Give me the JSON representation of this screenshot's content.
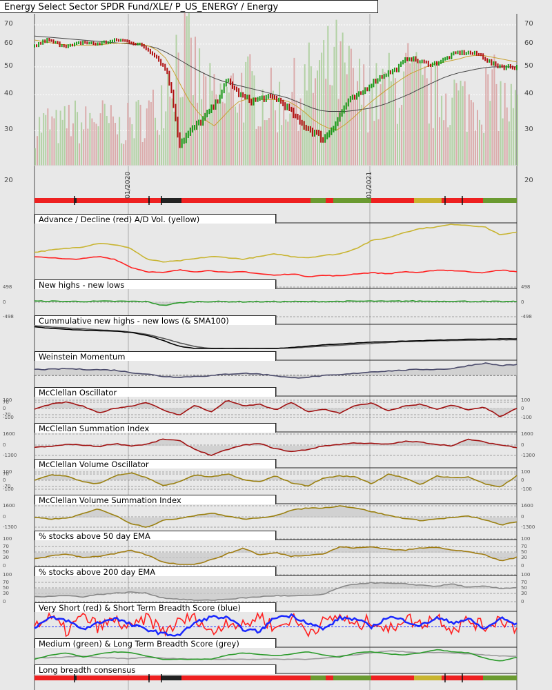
{
  "title": "Energy Select Sector SPDR Fund/XLE/ P_US_ENERGY / Energy",
  "chart_data": {
    "type": "line",
    "x_ticks": [
      "01/2020",
      "01/2021"
    ],
    "price": {
      "y_ticks": [
        "70",
        "60",
        "50",
        "40",
        "30",
        "20"
      ],
      "close": [
        59,
        62,
        60,
        59,
        61,
        60,
        61,
        62,
        61,
        59,
        55,
        48,
        27,
        30,
        33,
        37,
        45,
        40,
        38,
        39,
        39,
        36,
        32,
        30,
        28,
        32,
        38,
        40,
        44,
        47,
        49,
        54,
        52,
        51,
        53,
        56,
        56,
        55,
        51,
        50,
        50
      ],
      "sma200": [
        64,
        63.5,
        63,
        62.5,
        62,
        61.5,
        61,
        60.5,
        60,
        59.5,
        58.5,
        56,
        53,
        50,
        47.5,
        45.5,
        44,
        43,
        42,
        41,
        40,
        39,
        37.5,
        36,
        35,
        35,
        35,
        35.5,
        36,
        37,
        38.5,
        40,
        42,
        44,
        46,
        47.5,
        48.5,
        49.5,
        50,
        50,
        50
      ],
      "sma50": [
        62,
        61,
        60,
        59.5,
        59.5,
        59.5,
        60,
        60.5,
        60.5,
        60,
        58,
        53,
        44,
        37,
        33,
        31,
        35,
        38,
        39,
        38.5,
        38.5,
        38,
        36,
        33,
        31,
        30,
        32,
        35,
        38,
        41,
        44,
        47,
        49,
        51,
        52,
        53,
        54.5,
        55,
        54,
        53,
        52
      ],
      "volume": [
        30,
        35,
        30,
        38,
        32,
        40,
        35,
        30,
        35,
        40,
        45,
        70,
        95,
        80,
        60,
        50,
        55,
        65,
        60,
        55,
        50,
        55,
        60,
        70,
        75,
        80,
        70,
        60,
        55,
        60,
        65,
        70,
        60,
        55,
        60,
        55,
        50,
        55,
        60,
        50,
        45
      ]
    },
    "panels": [
      {
        "title": "Advance / Decline (red) A/D Vol. (yellow)",
        "series": [
          {
            "name": "A/D Vol.",
            "color": "#c8b430",
            "values": [
              48,
              52,
              55,
              58,
              65,
              62,
              55,
              35,
              30,
              32,
              36,
              40,
              38,
              35,
              40,
              45,
              40,
              38,
              42,
              45,
              55,
              70,
              75,
              85,
              92,
              95,
              100,
              98,
              95,
              80,
              85
            ]
          },
          {
            "name": "Advance / Decline",
            "color": "#ff2020",
            "values": [
              40,
              38,
              35,
              36,
              40,
              35,
              20,
              12,
              10,
              15,
              12,
              14,
              10,
              12,
              8,
              5,
              8,
              3,
              5,
              4,
              8,
              10,
              8,
              12,
              10,
              15,
              14,
              12,
              10,
              15,
              12
            ]
          }
        ]
      },
      {
        "title": "New highs - new lows",
        "ticks": [
          "498",
          "0",
          "-498"
        ],
        "series": [
          {
            "name": "NH-NL",
            "color": "#2a9a2a",
            "values": [
              30,
              25,
              20,
              18,
              22,
              25,
              20,
              10,
              -150,
              -40,
              10,
              15,
              10,
              5,
              8,
              10,
              12,
              10,
              15,
              20,
              25,
              30,
              20,
              35,
              30,
              25,
              30,
              20,
              15,
              10,
              12
            ]
          }
        ]
      },
      {
        "title": "Cummulative new highs - new lows (& SMA100)",
        "series": [
          {
            "name": "SMA100",
            "color": "#555",
            "values": [
              100,
              95,
              90,
              86,
              82,
              78,
              72,
              62,
              45,
              25,
              8,
              0,
              0,
              0,
              0,
              0,
              2,
              6,
              10,
              14,
              18,
              22,
              26,
              30,
              32,
              34,
              35,
              36,
              37,
              38,
              38
            ]
          },
          {
            "name": "Cumulative",
            "color": "#000",
            "values": [
              95,
              88,
              84,
              80,
              78,
              76,
              70,
              58,
              35,
              10,
              0,
              0,
              0,
              0,
              0,
              0,
              4,
              10,
              16,
              20,
              24,
              28,
              30,
              32,
              34,
              36,
              38,
              40,
              41,
              42,
              42
            ]
          }
        ]
      },
      {
        "title": "Weinstein Momentum",
        "series": [
          {
            "name": "Momentum",
            "color": "#4a4a6a",
            "values": [
              50,
              50,
              55,
              50,
              48,
              45,
              30,
              20,
              5,
              0,
              5,
              10,
              20,
              25,
              20,
              10,
              -5,
              0,
              10,
              15,
              25,
              35,
              40,
              45,
              50,
              50,
              55,
              75,
              90,
              75,
              80
            ]
          }
        ]
      },
      {
        "title": "McClellan Oscillator",
        "ticks": [
          "100",
          "70",
          "0",
          "-70",
          "-100"
        ],
        "series": [
          {
            "name": "Oscillator",
            "color": "#a01010",
            "values": [
              -10,
              40,
              60,
              20,
              -50,
              0,
              20,
              60,
              -20,
              -70,
              30,
              -40,
              80,
              20,
              40,
              -20,
              60,
              -40,
              -10,
              -50,
              30,
              50,
              -30,
              20,
              40,
              -10,
              30,
              -20,
              10,
              -90,
              0
            ]
          }
        ]
      },
      {
        "title": "McClellan Summation Index",
        "ticks": [
          "1600",
          "0",
          "-1300"
        ],
        "series": [
          {
            "name": "Summation",
            "color": "#a01010",
            "values": [
              -200,
              -100,
              200,
              100,
              -100,
              300,
              0,
              200,
              900,
              700,
              -500,
              -1300,
              -500,
              100,
              300,
              -400,
              -800,
              -500,
              0,
              200,
              400,
              300,
              200,
              600,
              500,
              200,
              0,
              900,
              500,
              100,
              -200
            ]
          }
        ]
      },
      {
        "title": "McClellan Volume Oscillator",
        "ticks": [
          "100",
          "70",
          "0",
          "-70",
          "-100"
        ],
        "series": [
          {
            "name": "Vol Oscillator",
            "color": "#9a8010",
            "values": [
              0,
              50,
              40,
              -20,
              -40,
              40,
              70,
              20,
              -60,
              -20,
              50,
              30,
              60,
              0,
              -20,
              40,
              -30,
              -60,
              20,
              40,
              30,
              -40,
              60,
              20,
              -50,
              40,
              20,
              30,
              -40,
              -70,
              40
            ]
          }
        ]
      },
      {
        "title": "McClellan Volume Summation Index",
        "ticks": [
          "1600",
          "0",
          "-1300"
        ],
        "series": [
          {
            "name": "Vol Summation",
            "color": "#9a8010",
            "values": [
              0,
              -200,
              -100,
              500,
              1200,
              300,
              -800,
              -1300,
              -400,
              -100,
              300,
              600,
              200,
              -200,
              -100,
              300,
              1000,
              1300,
              1300,
              1600,
              1300,
              800,
              300,
              -100,
              -400,
              -200,
              0,
              200,
              -300,
              -1000,
              -600
            ]
          }
        ]
      },
      {
        "title": "% stocks above 50 day EMA",
        "ticks": [
          "100",
          "70",
          "50",
          "30",
          "0"
        ],
        "series": [
          {
            "name": "% > 50 EMA",
            "color": "#a07c10",
            "values": [
              25,
              35,
              45,
              30,
              35,
              45,
              60,
              40,
              10,
              0,
              0,
              20,
              45,
              70,
              40,
              50,
              35,
              40,
              45,
              75,
              70,
              75,
              65,
              60,
              70,
              75,
              60,
              55,
              40,
              15,
              30
            ]
          }
        ]
      },
      {
        "title": "% stocks above 200 day EMA",
        "ticks": [
          "100",
          "70",
          "50",
          "30",
          "0"
        ],
        "series": [
          {
            "name": "% > 200 EMA",
            "color": "#888",
            "values": [
              15,
              18,
              20,
              15,
              25,
              30,
              35,
              30,
              10,
              5,
              0,
              0,
              5,
              10,
              15,
              20,
              18,
              20,
              25,
              55,
              70,
              75,
              72,
              70,
              65,
              60,
              70,
              55,
              60,
              50,
              55
            ]
          }
        ]
      },
      {
        "title": "Very Short (red) & Short Term Breadth Score (blue)",
        "series": [
          {
            "name": "Very Short",
            "color": "#ff2020",
            "values": [
              50,
              80,
              20,
              90,
              40,
              70,
              30,
              85,
              20,
              60,
              90,
              10,
              70,
              40,
              95,
              30,
              80,
              20,
              60,
              90,
              40,
              75,
              20,
              85,
              50,
              90,
              30,
              70,
              40,
              80,
              30
            ]
          },
          {
            "name": "Short",
            "color": "#1a28ff",
            "values": [
              40,
              80,
              70,
              30,
              60,
              80,
              50,
              30,
              10,
              5,
              60,
              85,
              80,
              30,
              20,
              85,
              90,
              60,
              30,
              80,
              75,
              40,
              85,
              70,
              45,
              80,
              60,
              75,
              30,
              80,
              50
            ]
          }
        ]
      },
      {
        "title": "Medium (green) & Long Term Breadth Score (grey)",
        "series": [
          {
            "name": "Long",
            "color": "#999",
            "values": [
              10,
              15,
              20,
              30,
              15,
              10,
              5,
              20,
              10,
              5,
              0,
              0,
              0,
              0,
              0,
              0,
              0,
              0,
              10,
              30,
              40,
              60,
              80,
              70,
              60,
              65,
              60,
              50,
              40,
              30,
              25
            ]
          },
          {
            "name": "Medium",
            "color": "#2a9a2a",
            "values": [
              0,
              40,
              60,
              20,
              50,
              70,
              60,
              30,
              0,
              0,
              0,
              0,
              40,
              60,
              45,
              30,
              50,
              70,
              40,
              20,
              60,
              70,
              50,
              40,
              60,
              90,
              70,
              60,
              10,
              -20,
              20
            ]
          }
        ]
      },
      {
        "title": "Long breadth consensus",
        "series": []
      }
    ]
  }
}
